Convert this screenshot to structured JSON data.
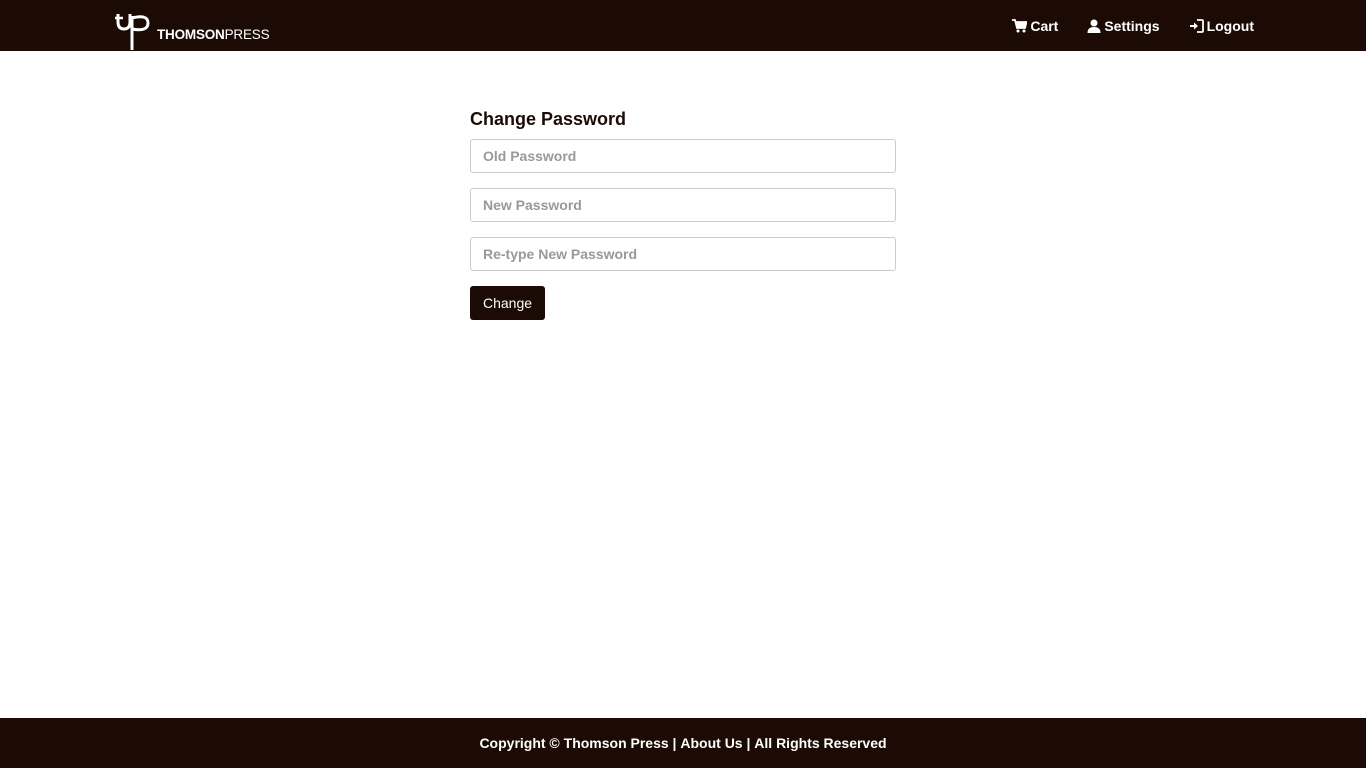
{
  "brand": {
    "logo_mark": "tp",
    "name_bold": "THOMSON",
    "name_light": "PRESS"
  },
  "nav": {
    "cart": {
      "label": "Cart",
      "icon": "cart-icon"
    },
    "settings": {
      "label": "Settings",
      "icon": "user-icon"
    },
    "logout": {
      "label": "Logout",
      "icon": "login-icon"
    }
  },
  "form": {
    "title": "Change Password",
    "old_password": {
      "placeholder": "Old Password",
      "value": ""
    },
    "new_password": {
      "placeholder": "New Password",
      "value": ""
    },
    "retype_password": {
      "placeholder": "Re-type New Password",
      "value": ""
    },
    "submit_label": "Change"
  },
  "footer": {
    "copyright": "Copyright © Thomson Press",
    "separator": " | ",
    "about": "About Us",
    "rights": "All Rights Reserved"
  },
  "colors": {
    "bar_background": "#1b0b04",
    "page_background": "#ffffff"
  }
}
